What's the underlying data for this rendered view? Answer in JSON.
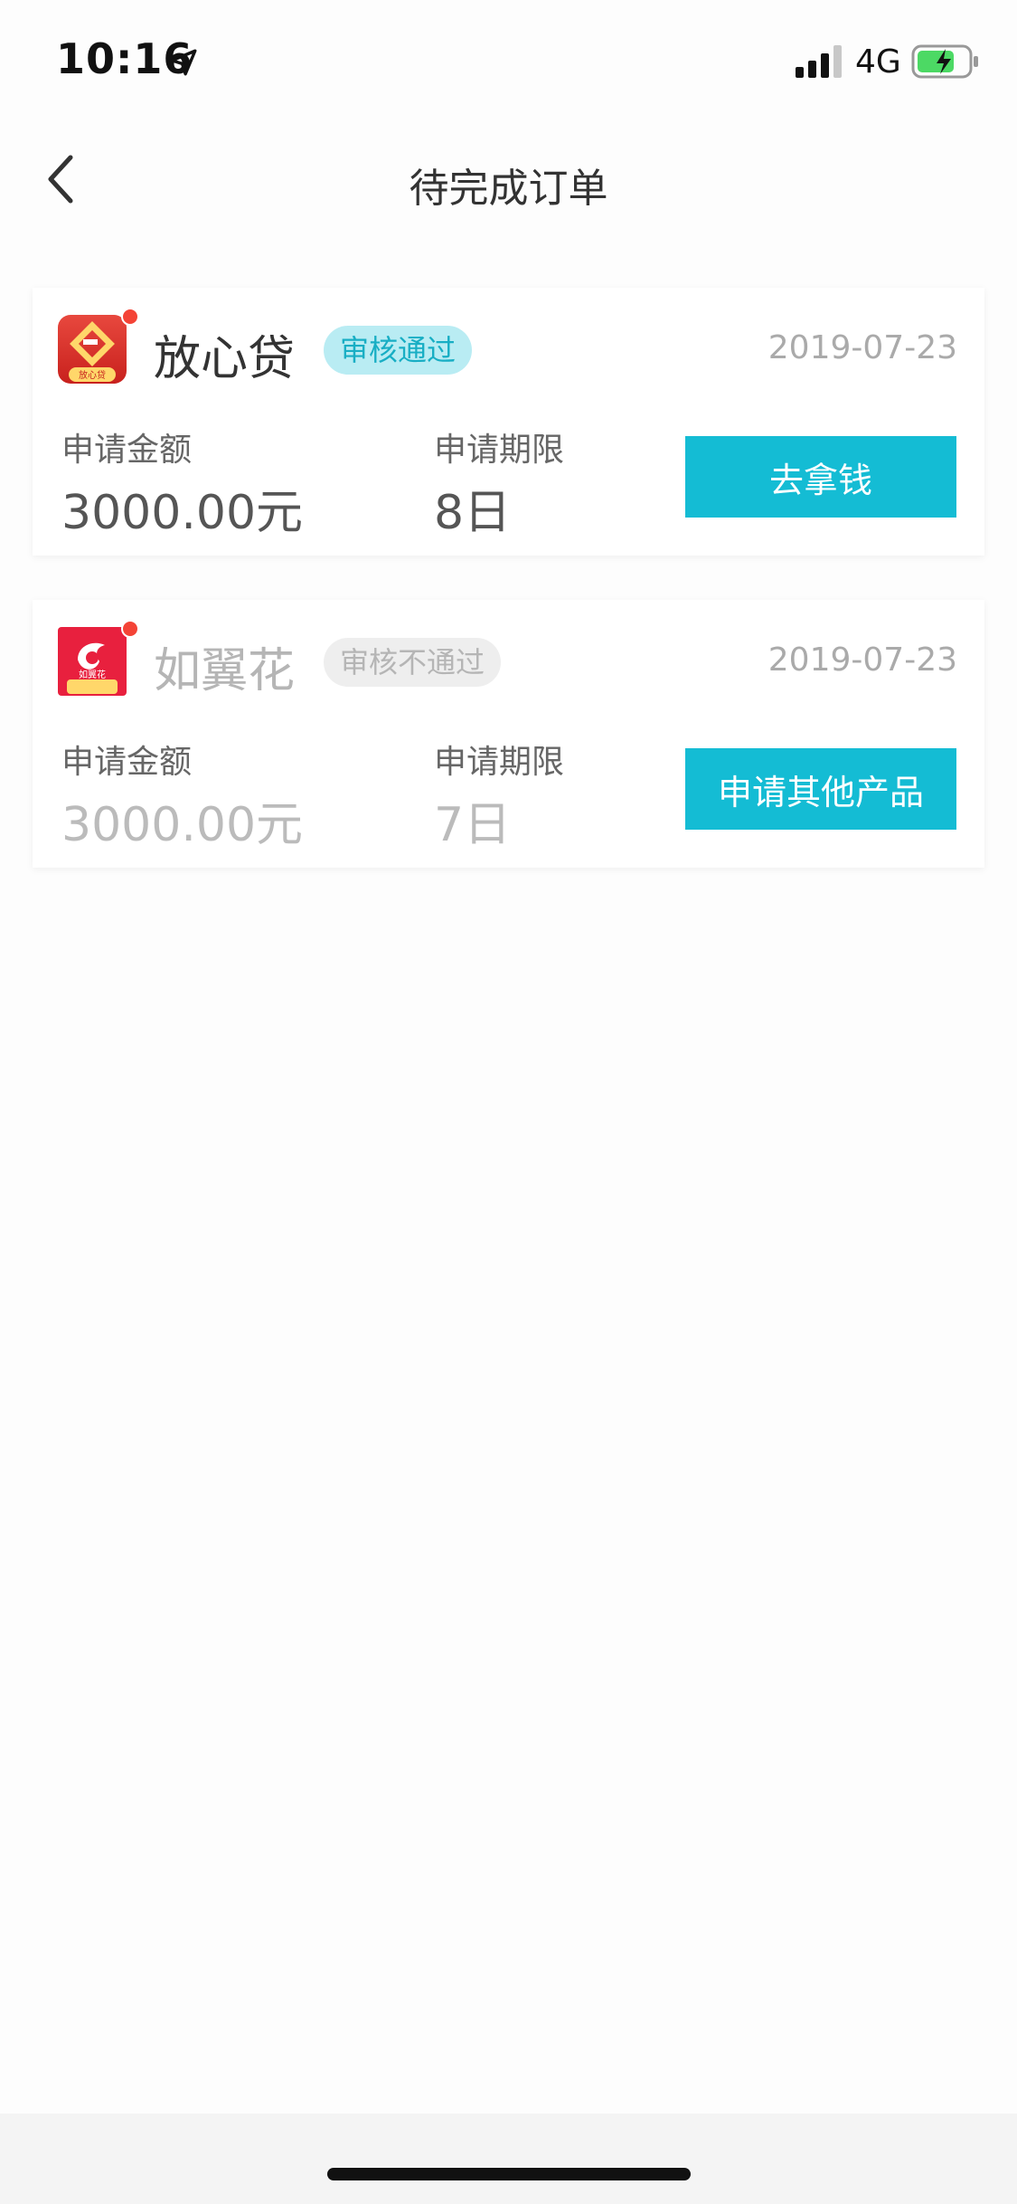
{
  "status_bar": {
    "time": "10:16",
    "network": "4G",
    "icons": [
      "location-arrow-icon",
      "signal-icon",
      "battery-charging-icon"
    ]
  },
  "nav": {
    "title": "待完成订单",
    "back_icon": "chevron-left-icon"
  },
  "orders": [
    {
      "product_name": "放心贷",
      "logo_text": "放心贷",
      "status": "审核通过",
      "date": "2019-07-23",
      "amount_label": "申请金额",
      "amount_value": "3000.00元",
      "term_label": "申请期限",
      "term_value": "8日",
      "action_label": "去拿钱"
    },
    {
      "product_name": "如翼花",
      "logo_text": "如翼花",
      "status": "审核不通过",
      "date": "2019-07-23",
      "amount_label": "申请金额",
      "amount_value": "3000.00元",
      "term_label": "申请期限",
      "term_value": "7日",
      "action_label": "申请其他产品"
    }
  ],
  "colors": {
    "accent": "#14bcd4",
    "badge_pass_bg": "#b9ecf3",
    "badge_pass_text": "#18aec4",
    "badge_fail_bg": "#eeeeee",
    "notification_dot": "#f44336"
  }
}
